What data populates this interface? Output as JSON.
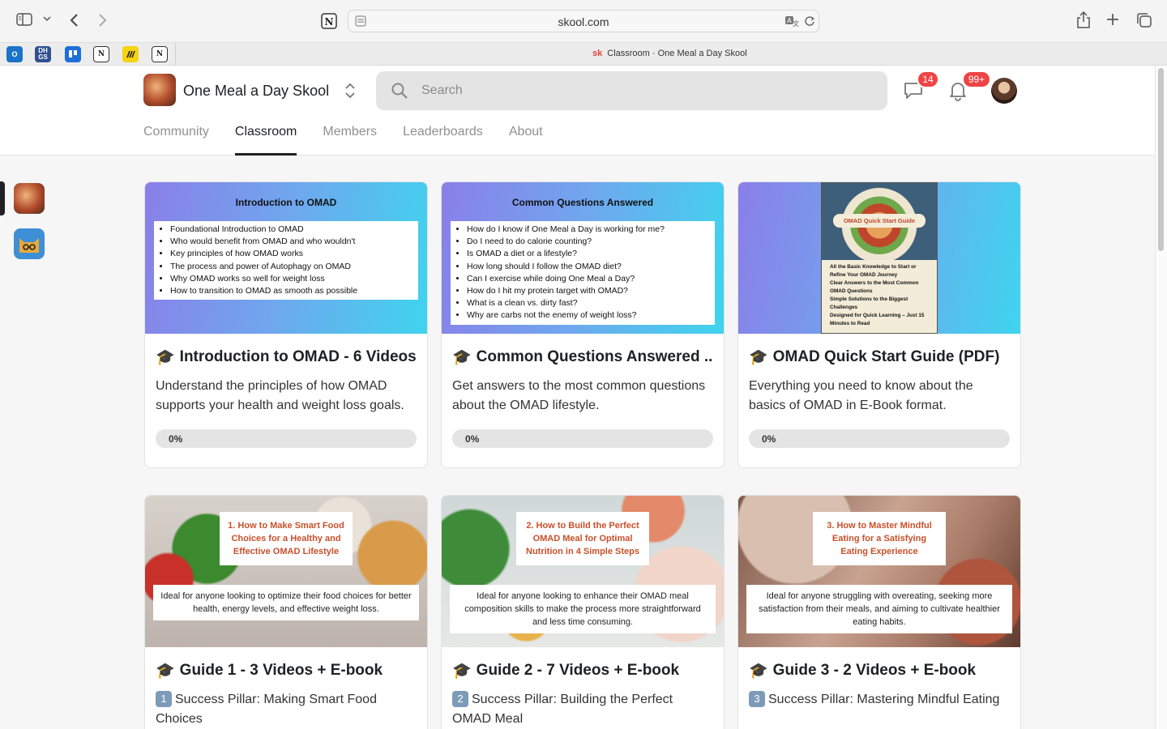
{
  "browser": {
    "url": "skool.com",
    "tab_title": "Classroom · One Meal a Day Skool",
    "tab_favicon": "sk",
    "favorites": [
      {
        "label": "",
        "icon": "outlook-icon",
        "color": "#1a73c8"
      },
      {
        "label": "DH GS",
        "icon": "dhgs-icon",
        "color": "#2f4f8f"
      },
      {
        "label": "",
        "icon": "trello-icon",
        "color": "#1d6fd8"
      },
      {
        "label": "N",
        "icon": "notion-icon",
        "color": "#fff"
      },
      {
        "label": "",
        "icon": "miro-icon",
        "color": "#f5d30f"
      },
      {
        "label": "N",
        "icon": "notion-icon",
        "color": "#fff"
      }
    ]
  },
  "header": {
    "group_name": "One Meal a Day Skool",
    "search_placeholder": "Search",
    "chat_badge": "14",
    "notif_badge": "99+",
    "nav": [
      "Community",
      "Classroom",
      "Members",
      "Leaderboards",
      "About"
    ],
    "active_nav": "Classroom"
  },
  "courses": [
    {
      "title": "Introduction to OMAD - 6 Videos",
      "description": "Understand the principles of how OMAD supports your health and weight loss goals.",
      "progress": "0%",
      "thumb_title": "Introduction to OMAD",
      "thumb_bullets": [
        "Foundational Introduction to OMAD",
        "Who would benefit from OMAD and who wouldn't",
        "Key principles of how OMAD works",
        "The process and power of Autophagy on OMAD",
        "Why OMAD works so well for weight loss",
        "How to transition to OMAD as smooth as possible"
      ]
    },
    {
      "title": "Common Questions Answered ...",
      "description": "Get answers to the most common questions about the OMAD lifestyle.",
      "progress": "0%",
      "thumb_title": "Common Questions Answered",
      "thumb_bullets": [
        "How do I know if One Meal a Day is working for me?",
        "Do I need to do calorie counting?",
        "Is OMAD a diet or a lifestyle?",
        "How long should I follow the OMAD diet?",
        "Can I exercise while doing One Meal a Day?",
        "How do I hit my protein target with OMAD?",
        "What is a clean vs. dirty fast?",
        "Why are carbs not the enemy of weight loss?"
      ]
    },
    {
      "title": "OMAD Quick Start Guide (PDF)",
      "description": "Everything you need to know about the basics of OMAD in E-Book format.",
      "progress": "0%",
      "thumb_title": "OMAD Quick Start Guide",
      "thumb_bullets": [
        "All the Basic Knowledge to Start or Refine Your OMAD Journey",
        "Clear Answers to the Most Common OMAD Questions",
        "Simple Solutions to the Biggest Challenges",
        "Designed for Quick Learning – Just 15 Minutes to Read"
      ]
    },
    {
      "title": "Guide 1 - 3 Videos + E-book",
      "description": "Success Pillar: Making Smart Food Choices",
      "number": "1",
      "thumb_title": "1. How to Make Smart Food Choices for a Healthy and Effective OMAD Lifestyle",
      "thumb_desc": "Ideal for anyone looking to optimize their food choices for better health, energy levels, and effective weight loss."
    },
    {
      "title": "Guide 2 - 7 Videos + E-book",
      "description": "Success Pillar: Building the Perfect OMAD Meal",
      "number": "2",
      "thumb_title": "2. How to Build the Perfect OMAD Meal for Optimal Nutrition in 4 Simple Steps",
      "thumb_desc": "Ideal for anyone looking to enhance their OMAD meal composition skills to make the process more straightforward and less time consuming."
    },
    {
      "title": "Guide 3 - 2 Videos + E-book",
      "description": "Success Pillar: Mastering Mindful Eating",
      "number": "3",
      "thumb_title": "3. How to Master Mindful Eating for a Satisfying Eating Experience",
      "thumb_desc": "Ideal for anyone struggling with overeating, seeking more satisfaction from their meals, and aiming to cultivate healthier eating habits."
    }
  ]
}
